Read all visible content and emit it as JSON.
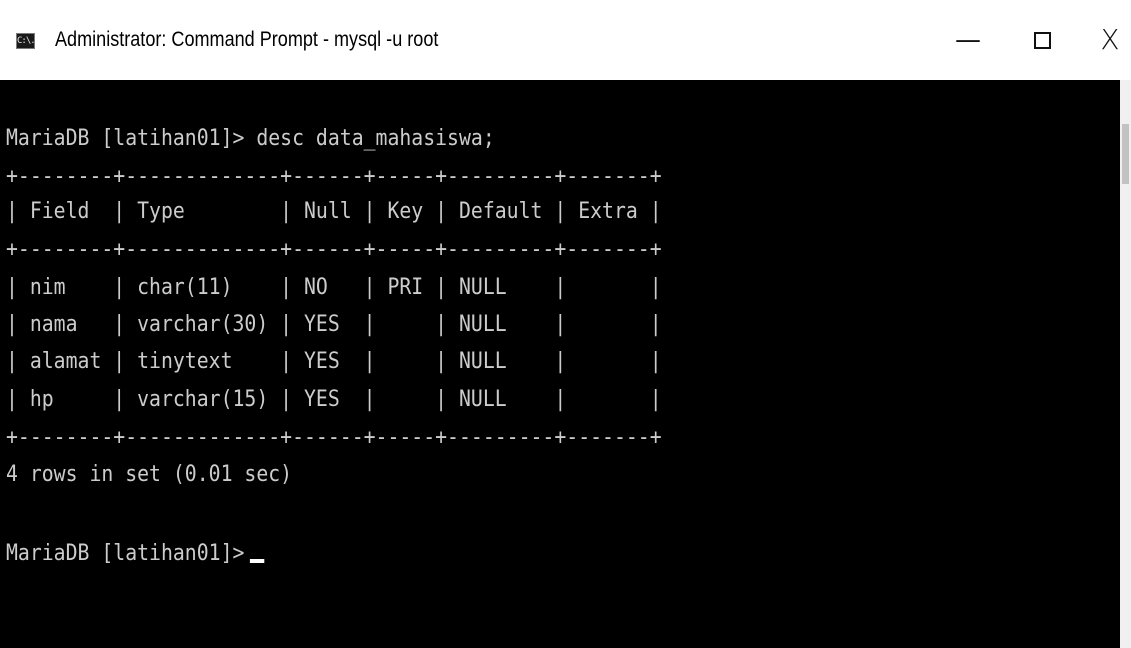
{
  "window": {
    "title": "Administrator: Command Prompt - mysql  -u root",
    "icon": "cmd-icon",
    "icon_glyph": "C:\\.",
    "controls": {
      "minimize": "—",
      "close": "X"
    }
  },
  "console": {
    "lines": [
      "MariaDB [latihan01]> desc data_mahasiswa;",
      "+--------+-------------+------+-----+---------+-------+",
      "| Field  | Type        | Null | Key | Default | Extra |",
      "+--------+-------------+------+-----+---------+-------+",
      "| nim    | char(11)    | NO   | PRI | NULL    |       |",
      "| nama   | varchar(30) | YES  |     | NULL    |       |",
      "| alamat | tinytext    | YES  |     | NULL    |       |",
      "| hp     | varchar(15) | YES  |     | NULL    |       |",
      "+--------+-------------+------+-----+---------+-------+",
      "4 rows in set (0.01 sec)",
      "MariaDB [latihan01]>"
    ],
    "table": {
      "columns": [
        "Field",
        "Type",
        "Null",
        "Key",
        "Default",
        "Extra"
      ],
      "rows": [
        [
          "nim",
          "char(11)",
          "NO",
          "PRI",
          "NULL",
          ""
        ],
        [
          "nama",
          "varchar(30)",
          "YES",
          "",
          "NULL",
          ""
        ],
        [
          "alamat",
          "tinytext",
          "YES",
          "",
          "NULL",
          ""
        ],
        [
          "hp",
          "varchar(15)",
          "YES",
          "",
          "NULL",
          ""
        ]
      ]
    }
  },
  "colors": {
    "console_background": "#000000",
    "console_text": "#cccccc",
    "titlebar_background": "#ffffff"
  }
}
